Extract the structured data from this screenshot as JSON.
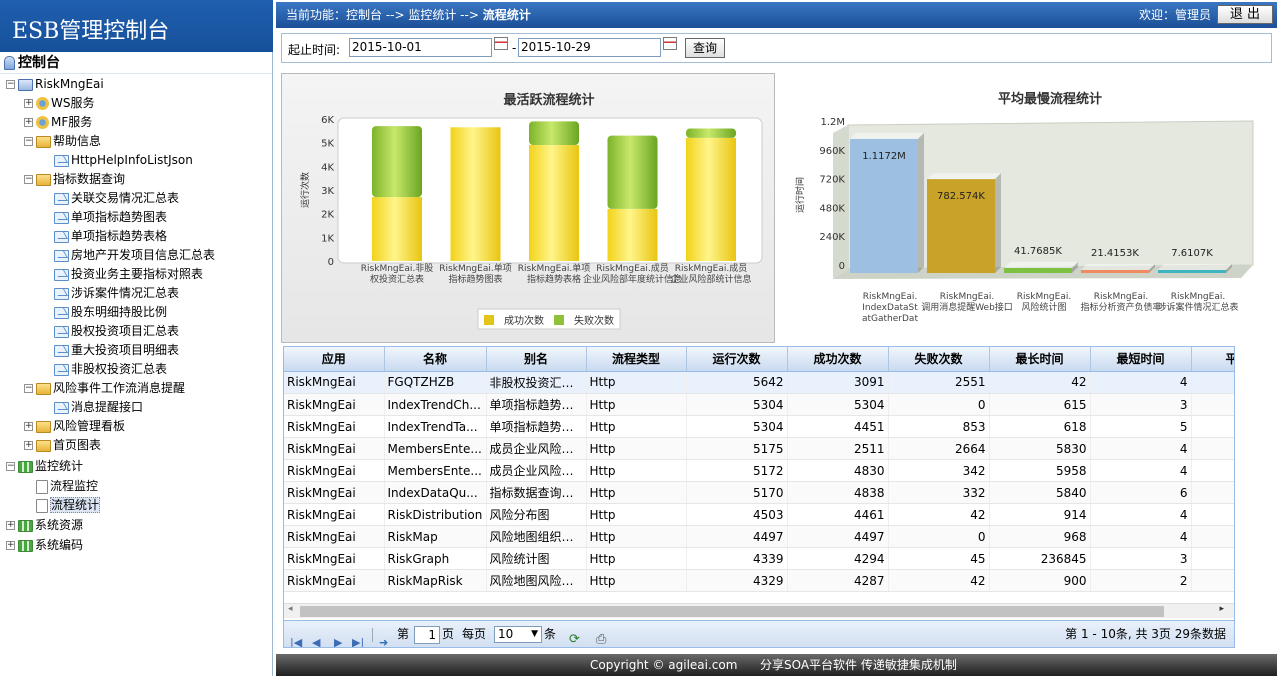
{
  "app": {
    "title": "ESB管理控制台"
  },
  "header": {
    "crumb_prefix": "当前功能：控制台 --> 监控统计 --> ",
    "crumb_current": "流程统计",
    "welcome": "欢迎：管理员",
    "logout_label": "退 出"
  },
  "tree": {
    "root": "控制台",
    "items": [
      {
        "label": "RiskMngEai",
        "level": 0,
        "toggle": "−",
        "icon": "app"
      },
      {
        "label": "WS服务",
        "level": 1,
        "toggle": "+",
        "icon": "gear"
      },
      {
        "label": "MF服务",
        "level": 1,
        "toggle": "+",
        "icon": "gear"
      },
      {
        "label": "帮助信息",
        "level": 1,
        "toggle": "−",
        "icon": "folder"
      },
      {
        "label": "HttpHelpInfoListJson",
        "level": 2,
        "toggle": "",
        "icon": "mail"
      },
      {
        "label": "指标数据查询",
        "level": 1,
        "toggle": "−",
        "icon": "folder"
      },
      {
        "label": "关联交易情况汇总表",
        "level": 2,
        "toggle": "",
        "icon": "mail"
      },
      {
        "label": "单项指标趋势图表",
        "level": 2,
        "toggle": "",
        "icon": "mail"
      },
      {
        "label": "单项指标趋势表格",
        "level": 2,
        "toggle": "",
        "icon": "mail"
      },
      {
        "label": "房地产开发项目信息汇总表",
        "level": 2,
        "toggle": "",
        "icon": "mail"
      },
      {
        "label": "投资业务主要指标对照表",
        "level": 2,
        "toggle": "",
        "icon": "mail"
      },
      {
        "label": "涉诉案件情况汇总表",
        "level": 2,
        "toggle": "",
        "icon": "mail"
      },
      {
        "label": "股东明细持股比例",
        "level": 2,
        "toggle": "",
        "icon": "mail"
      },
      {
        "label": "股权投资项目汇总表",
        "level": 2,
        "toggle": "",
        "icon": "mail"
      },
      {
        "label": "重大投资项目明细表",
        "level": 2,
        "toggle": "",
        "icon": "mail"
      },
      {
        "label": "非股权投资汇总表",
        "level": 2,
        "toggle": "",
        "icon": "mail"
      },
      {
        "label": "风险事件工作流消息提醒",
        "level": 1,
        "toggle": "−",
        "icon": "folder"
      },
      {
        "label": "消息提醒接口",
        "level": 2,
        "toggle": "",
        "icon": "mail"
      },
      {
        "label": "风险管理看板",
        "level": 1,
        "toggle": "+",
        "icon": "folder"
      },
      {
        "label": "首页图表",
        "level": 1,
        "toggle": "+",
        "icon": "folder"
      },
      {
        "label": "监控统计",
        "level": 0,
        "toggle": "−",
        "icon": "grid"
      },
      {
        "label": "流程监控",
        "level": 1,
        "toggle": "",
        "icon": "doc"
      },
      {
        "label": "流程统计",
        "level": 1,
        "toggle": "",
        "icon": "doc",
        "selected": true
      },
      {
        "label": "系统资源",
        "level": 0,
        "toggle": "+",
        "icon": "grid"
      },
      {
        "label": "系统编码",
        "level": 0,
        "toggle": "+",
        "icon": "grid"
      }
    ]
  },
  "search": {
    "start_label": "起止时间:",
    "start_value": "2015-10-01",
    "sep": "-",
    "end_value": "2015-10-29",
    "query_label": "查询"
  },
  "chart_data": [
    {
      "type": "bar",
      "title": "最活跃流程统计",
      "ylabel": "运行次数",
      "ylim": [
        0,
        6000
      ],
      "yticks": [
        "0",
        "1K",
        "2K",
        "3K",
        "4K",
        "5K",
        "6K"
      ],
      "categories": [
        "RiskMngEai.非股权投资汇总表",
        "RiskMngEai.单项指标趋势图表",
        "RiskMngEai.单项指标趋势表格",
        "RiskMngEai.成员企业风险部年度统计信息",
        "RiskMngEai.成员企业风险部统计信息"
      ],
      "series": [
        {
          "name": "成功次数",
          "values": [
            2700,
            5650,
            4900,
            2200,
            5200
          ]
        },
        {
          "name": "失败次数",
          "values": [
            3000,
            0,
            1000,
            3100,
            400
          ]
        }
      ],
      "legend": "bottom"
    },
    {
      "type": "bar",
      "title": "平均最慢流程统计",
      "ylabel": "运行时间",
      "ylim": [
        0,
        1200000
      ],
      "yticks": [
        "0",
        "240K",
        "480K",
        "720K",
        "960K",
        "1.2M"
      ],
      "categories": [
        "RiskMngEai.IndexDataStatGatherData",
        "RiskMngEai.调用消息提醒Web接口",
        "RiskMngEai.风险统计图",
        "RiskMngEai.指标分析资产负债率",
        "RiskMngEai.涉诉案件情况汇总表"
      ],
      "values": [
        1117200,
        782574,
        41768.5,
        21415.3,
        7610.7
      ],
      "data_labels": [
        "1.1172M",
        "782.574K",
        "41.7685K",
        "21.4153K",
        "7.6107K"
      ],
      "colors": [
        "#9dbfe2",
        "#c9a228",
        "#7cc142",
        "#f08a60",
        "#3fb5bf"
      ]
    }
  ],
  "grid": {
    "columns": [
      "应用",
      "名称",
      "别名",
      "流程类型",
      "运行次数",
      "成功次数",
      "失败次数",
      "最长时间",
      "最短时间",
      "平均"
    ],
    "rows": [
      [
        "RiskMngEai",
        "FGQTZHZB",
        "非股权投资汇总表",
        "Http",
        "5642",
        "3091",
        "2551",
        "42",
        "4"
      ],
      [
        "RiskMngEai",
        "IndexTrendCh...",
        "单项指标趋势图表",
        "Http",
        "5304",
        "5304",
        "0",
        "615",
        "3"
      ],
      [
        "RiskMngEai",
        "IndexTrendTa...",
        "单项指标趋势表格",
        "Http",
        "5304",
        "4451",
        "853",
        "618",
        "5"
      ],
      [
        "RiskMngEai",
        "MembersEnte...",
        "成员企业风险部...",
        "Http",
        "5175",
        "2511",
        "2664",
        "5830",
        "4"
      ],
      [
        "RiskMngEai",
        "MembersEnte...",
        "成员企业风险部...",
        "Http",
        "5172",
        "4830",
        "342",
        "5958",
        "4"
      ],
      [
        "RiskMngEai",
        "IndexDataQu...",
        "指标数据查询统计",
        "Http",
        "5170",
        "4838",
        "332",
        "5840",
        "6"
      ],
      [
        "RiskMngEai",
        "RiskDistribution",
        "风险分布图",
        "Http",
        "4503",
        "4461",
        "42",
        "914",
        "4"
      ],
      [
        "RiskMngEai",
        "RiskMap",
        "风险地图组织列表",
        "Http",
        "4497",
        "4497",
        "0",
        "968",
        "4"
      ],
      [
        "RiskMngEai",
        "RiskGraph",
        "风险统计图",
        "Http",
        "4339",
        "4294",
        "45",
        "236845",
        "3"
      ],
      [
        "RiskMngEai",
        "RiskMapRisk",
        "风险地图风险部分",
        "Http",
        "4329",
        "4287",
        "42",
        "900",
        "2"
      ]
    ]
  },
  "pager": {
    "page_prefix": "第",
    "page_value": "1",
    "page_suffix": "页",
    "per_page_label": "每页",
    "per_page_value": "10",
    "per_page_suffix": "条",
    "summary": "第 1 - 10条, 共 3页 29条数据"
  },
  "footer": {
    "copyright": "Copyright © agileai.com",
    "tagline": "分享SOA平台软件  传递敏捷集成机制"
  }
}
